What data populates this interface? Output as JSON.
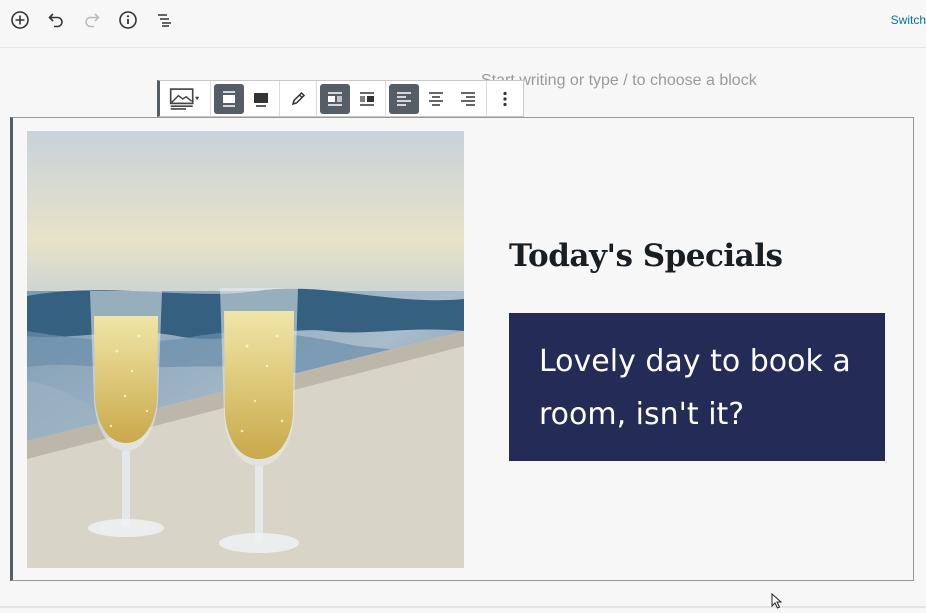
{
  "top_toolbar": {
    "icons": [
      "add-block-icon",
      "undo-icon",
      "redo-icon",
      "info-icon",
      "outline-icon"
    ],
    "switch_label": "Switch"
  },
  "editor": {
    "placeholder": "Start writing or type / to choose a block"
  },
  "block_toolbar": {
    "icons": [
      "media-text-icon",
      "align-wide-icon",
      "align-full-icon",
      "edit-pencil-icon",
      "media-left-icon",
      "media-right-icon",
      "align-left-icon",
      "align-center-icon",
      "align-right-icon",
      "more-options-icon"
    ]
  },
  "media_text": {
    "heading": "Today's Specials",
    "callout": "Lovely day to book a room, isn't it?",
    "callout_bg": "#252b57",
    "image_description": "champagne-glasses-photo"
  },
  "colors": {
    "accent": "#0073aa",
    "active_button": "#555d66"
  }
}
